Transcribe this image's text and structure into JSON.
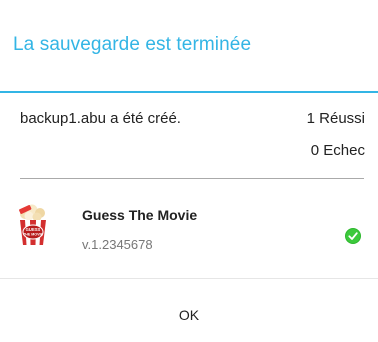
{
  "dialog": {
    "title": "La sauvegarde est terminée",
    "accent_color": "#33b5e5",
    "summary": {
      "message": "backup1.abu a été créé.",
      "success": "1 Réussi",
      "failure": "0 Echec"
    },
    "apps": [
      {
        "name": "Guess The Movie",
        "version": "v.1.2345678",
        "icon": "popcorn-app-icon",
        "icon_text": "GUESS THE MOVIE",
        "status": "success",
        "status_icon": "check-circle-icon",
        "status_color": "#2eb82e"
      }
    ],
    "ok_label": "OK"
  }
}
